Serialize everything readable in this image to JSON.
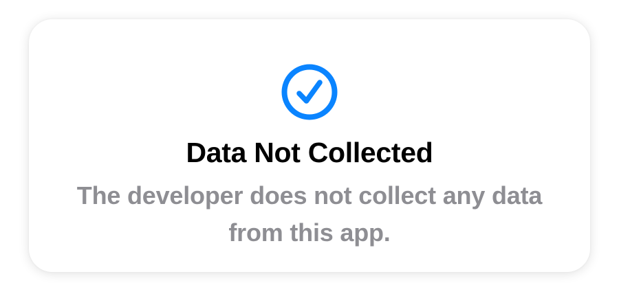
{
  "card": {
    "icon": "checkmark-circle-icon",
    "icon_color": "#0a84ff",
    "title": "Data Not Collected",
    "description": "The developer does not collect any data from this app."
  }
}
